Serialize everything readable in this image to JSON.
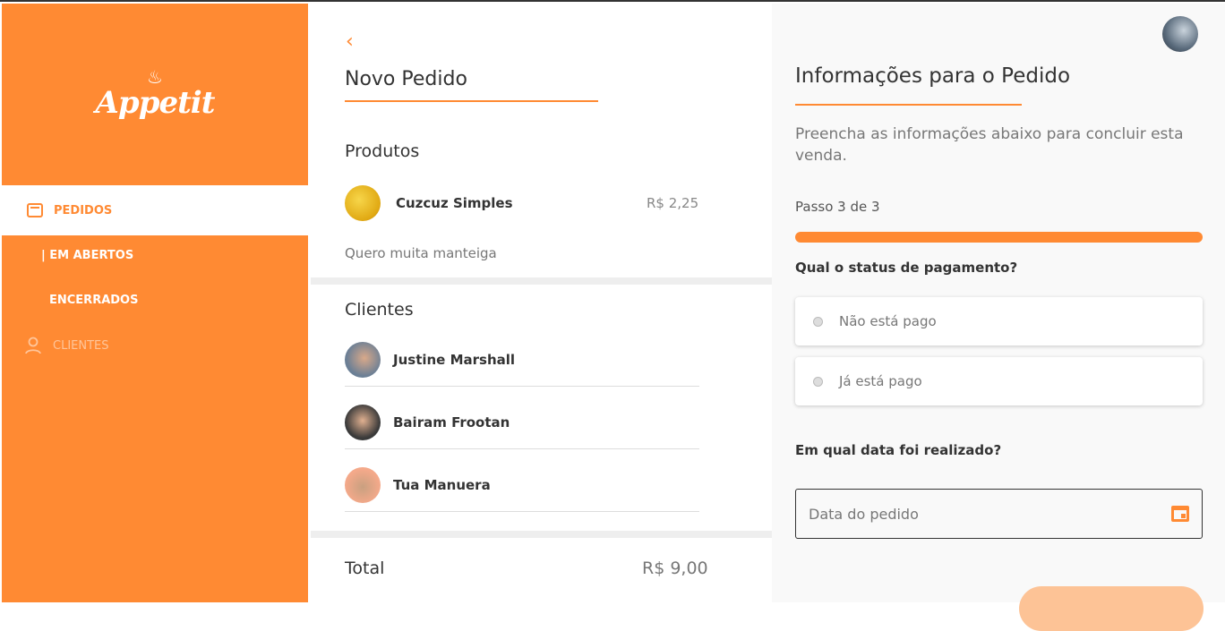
{
  "sidebar": {
    "logo_text": "Appetit",
    "items": [
      {
        "label": "PEDIDOS",
        "icon": "list-icon"
      },
      {
        "label": "EM ABERTOS"
      },
      {
        "label": "ENCERRADOS"
      },
      {
        "label": "CLIENTES",
        "icon": "user-icon"
      }
    ]
  },
  "order": {
    "title": "Novo Pedido",
    "products_heading": "Produtos",
    "products": [
      {
        "name": "Cuzcuz Simples",
        "price": "R$ 2,25",
        "note": "Quero muita manteiga"
      }
    ],
    "clients_heading": "Clientes",
    "clients": [
      {
        "name": "Justine Marshall"
      },
      {
        "name": "Bairam Frootan"
      },
      {
        "name": "Tua Manuera"
      }
    ],
    "total_label": "Total",
    "total_value": "R$ 9,00"
  },
  "info": {
    "title": "Informações para o Pedido",
    "description": "Preencha as informações abaixo para concluir esta venda.",
    "step": "Passo 3 de 3",
    "progress": 1.0,
    "payment_question": "Qual o status de pagamento?",
    "payment_options": [
      "Não está pago",
      "Já está pago"
    ],
    "date_question": "Em qual data foi realizado?",
    "date_placeholder": "Data do pedido"
  },
  "colors": {
    "accent": "#ff8a33"
  }
}
